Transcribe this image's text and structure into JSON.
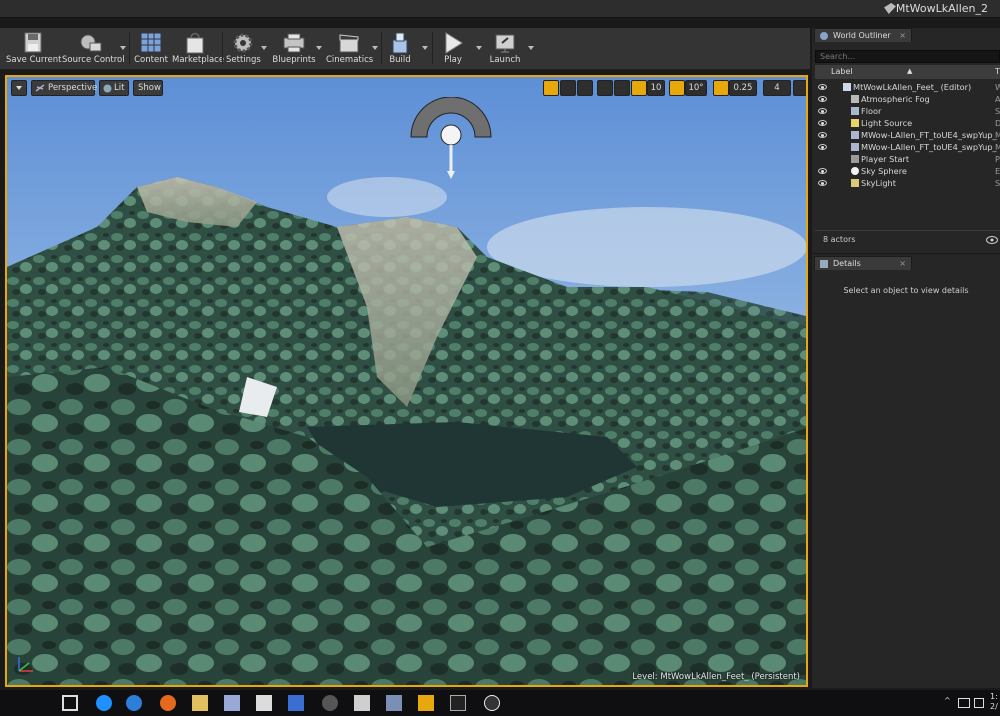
{
  "window": {
    "title": "MtWowLkAllen_2"
  },
  "toolbar": {
    "buttons": [
      {
        "label": "Save Current",
        "icon": "save-icon"
      },
      {
        "label": "Source Control",
        "icon": "source-control-icon"
      },
      {
        "label": "Content",
        "icon": "content-icon"
      },
      {
        "label": "Marketplace",
        "icon": "marketplace-icon"
      },
      {
        "label": "Settings",
        "icon": "gear-icon"
      },
      {
        "label": "Blueprints",
        "icon": "blueprints-icon"
      },
      {
        "label": "Cinematics",
        "icon": "clapperboard-icon"
      },
      {
        "label": "Build",
        "icon": "build-icon"
      },
      {
        "label": "Play",
        "icon": "play-icon"
      },
      {
        "label": "Launch",
        "icon": "launch-icon"
      }
    ]
  },
  "viewport": {
    "view_mode": "Perspective",
    "lighting": "Lit",
    "show": "Show",
    "grid_snap": "10",
    "rotation_snap": "10°",
    "scale_snap": "0.25",
    "camera_speed": "4",
    "level_label": "Level:",
    "level_name": "MtWowLkAllen_Feet_ (Persistent)"
  },
  "outliner": {
    "tab": "World Outliner",
    "search_placeholder": "Search...",
    "col_label": "Label",
    "col_type": "T",
    "rows": [
      {
        "name": "MtWowLkAllen_Feet_ (Editor)",
        "type": "W",
        "icon": "world-icon",
        "indent": 1
      },
      {
        "name": "Atmospheric Fog",
        "type": "A",
        "icon": "fog-icon",
        "indent": 2
      },
      {
        "name": "Floor",
        "type": "S",
        "icon": "mesh-icon",
        "indent": 2
      },
      {
        "name": "Light Source",
        "type": "D",
        "icon": "light-icon",
        "indent": 2
      },
      {
        "name": "MWow-LAllen_FT_toUE4_swpYup_",
        "type": "M",
        "icon": "mesh-icon",
        "indent": 2
      },
      {
        "name": "MWow-LAllen_FT_toUE4_swpYup_",
        "type": "M",
        "icon": "mesh-icon",
        "indent": 2
      },
      {
        "name": "Player Start",
        "type": "Pl",
        "icon": "player-start-icon",
        "indent": 2
      },
      {
        "name": "Sky Sphere",
        "type": "E",
        "icon": "sphere-icon",
        "indent": 2
      },
      {
        "name": "SkyLight",
        "type": "Sk",
        "icon": "skylight-icon",
        "indent": 2
      }
    ],
    "actor_count": "8 actors"
  },
  "details": {
    "tab": "Details",
    "empty_message": "Select an object to view details"
  },
  "taskbar": {
    "clock_time": "1:",
    "clock_date": "2/"
  },
  "colors": {
    "accent": "#e8a80c",
    "panel": "#262626",
    "toolbar": "#343434"
  }
}
